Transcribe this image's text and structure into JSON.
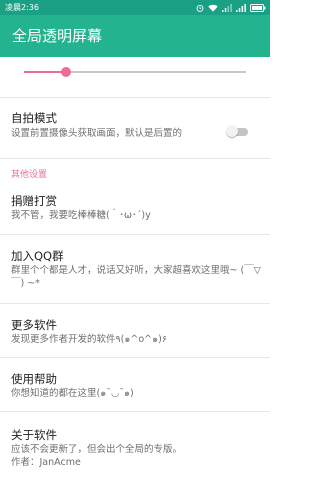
{
  "status_bar": {
    "time": "凌晨2:36"
  },
  "app_bar": {
    "title": "全局透明屏幕"
  },
  "slider": {
    "value_fraction": 0.19
  },
  "selfie_mode": {
    "title": "自拍模式",
    "summary": "设置前置摄像头获取画面，默认是后置的",
    "enabled": false
  },
  "other_settings": {
    "header": "其他设置",
    "items": [
      {
        "title": "捐赠打赏",
        "summary": "我不管，我要吃棒棒糖(｀･ω･´)y"
      },
      {
        "title": "加入QQ群",
        "summary": "群里个个都是人才，说话又好听，大家超喜欢这里哦~ (￣▽￣) ~*"
      },
      {
        "title": "更多软件",
        "summary": "发现更多作者开发的软件٩(๑^o^๑)۶"
      },
      {
        "title": "使用帮助",
        "summary": "你想知道的都在这里(๑¯◡¯๑)"
      },
      {
        "title": "关于软件",
        "summary": "应该不会更新了，但会出个全局的专版。",
        "author": "作者：JanAcme"
      }
    ]
  }
}
